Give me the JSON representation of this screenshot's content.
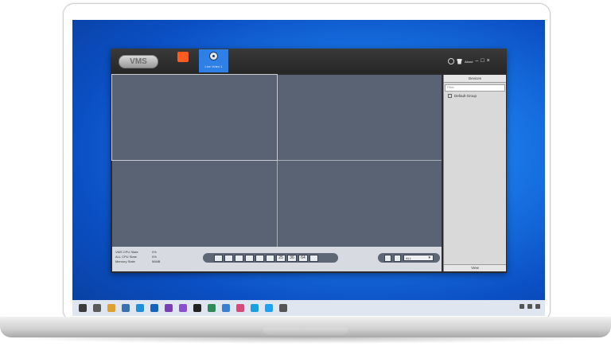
{
  "app": {
    "logo": "VMS",
    "tab_live_label": "Live Video 1",
    "about_label": "About",
    "win_min": "–",
    "win_max": "□",
    "win_close": "×"
  },
  "stats": [
    {
      "label": "VMS CPU State",
      "value": "0%"
    },
    {
      "label": "ALL CPU State",
      "value": "0%"
    },
    {
      "label": "Memory State",
      "value": "56MB"
    }
  ],
  "layout_buttons": [
    "25",
    "36",
    "64"
  ],
  "record": {
    "select_value": "ALL"
  },
  "devices": {
    "header": "Devices",
    "filter_placeholder": "Filter",
    "group": "Default Group",
    "footer": "View"
  },
  "taskbar_icons": [
    {
      "name": "task-view-icon",
      "color": "#3b3b3b"
    },
    {
      "name": "car-app-icon",
      "color": "#5a5a5a"
    },
    {
      "name": "folder-icon",
      "color": "#e0a030"
    },
    {
      "name": "calendar-icon",
      "color": "#3a6fb0"
    },
    {
      "name": "edge-icon",
      "color": "#1f8fd8"
    },
    {
      "name": "outlook-icon",
      "color": "#1565c0"
    },
    {
      "name": "onenote-icon",
      "color": "#7b3fb5"
    },
    {
      "name": "visual-studio-icon",
      "color": "#8a4fd0"
    },
    {
      "name": "terminal-icon",
      "color": "#222222"
    },
    {
      "name": "xbox-icon",
      "color": "#2e8b57"
    },
    {
      "name": "photos-icon",
      "color": "#3a7fd0"
    },
    {
      "name": "paint-icon",
      "color": "#d84a7a"
    },
    {
      "name": "skype-icon",
      "color": "#1aa0e0"
    },
    {
      "name": "twitter-icon",
      "color": "#1da1f2"
    },
    {
      "name": "settings-icon",
      "color": "#555555"
    }
  ]
}
